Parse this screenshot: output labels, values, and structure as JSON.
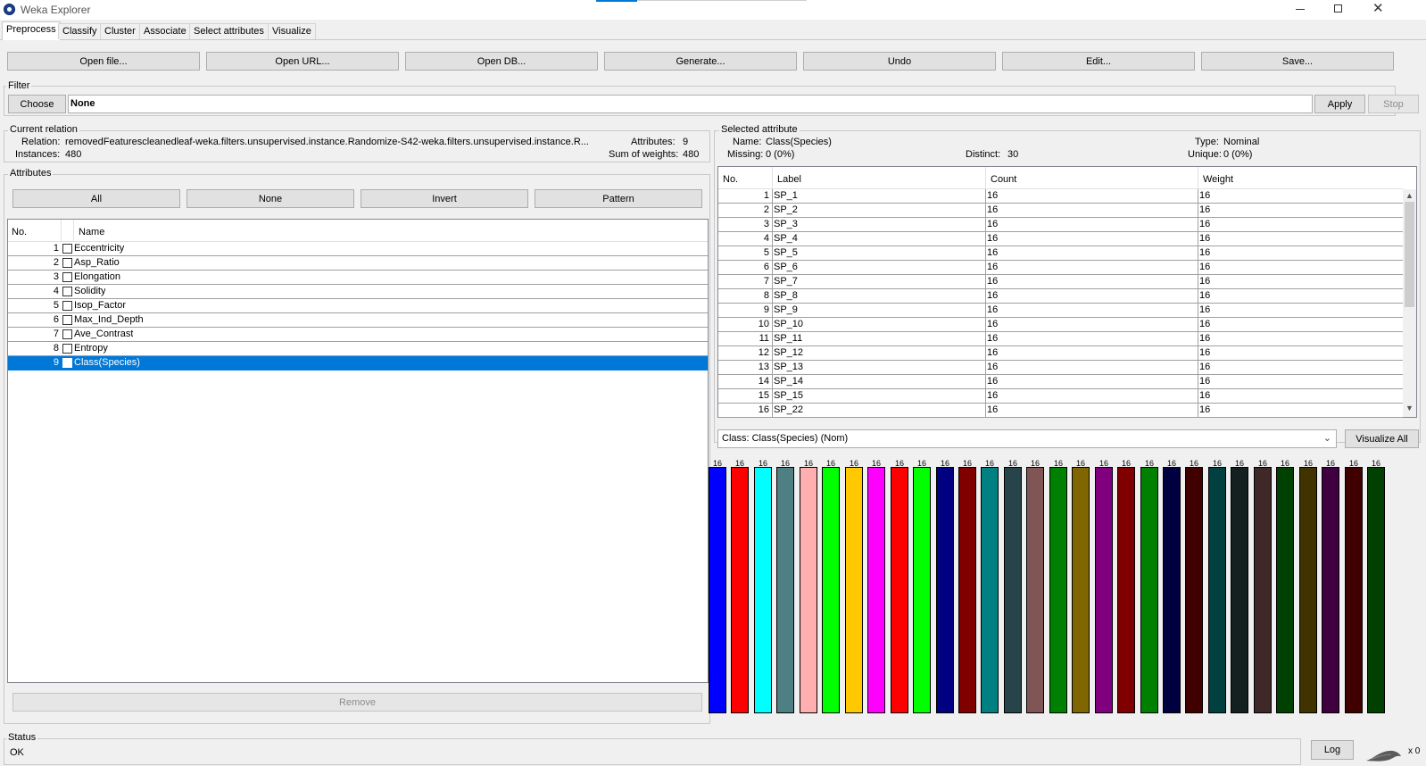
{
  "window": {
    "title": "Weka Explorer",
    "minimize_icon": "minimize-icon",
    "maximize_icon": "restore-icon",
    "close_icon": "close-icon"
  },
  "tabs": [
    "Preprocess",
    "Classify",
    "Cluster",
    "Associate",
    "Select attributes",
    "Visualize"
  ],
  "toolbar": {
    "open_file": "Open file...",
    "open_url": "Open URL...",
    "open_db": "Open DB...",
    "generate": "Generate...",
    "undo": "Undo",
    "edit": "Edit...",
    "save": "Save..."
  },
  "filter": {
    "legend": "Filter",
    "choose": "Choose",
    "value": "None",
    "apply": "Apply",
    "stop": "Stop"
  },
  "current_relation": {
    "legend": "Current relation",
    "relation_label": "Relation:",
    "relation_value": "removedFeaturescleanedleaf-weka.filters.unsupervised.instance.Randomize-S42-weka.filters.unsupervised.instance.R...",
    "instances_label": "Instances:",
    "instances_value": "480",
    "attributes_label": "Attributes:",
    "attributes_value": "9",
    "sum_weights_label": "Sum of weights:",
    "sum_weights_value": "480"
  },
  "attributes": {
    "legend": "Attributes",
    "all": "All",
    "none": "None",
    "invert": "Invert",
    "pattern": "Pattern",
    "col_no": "No.",
    "col_name": "Name",
    "rows": [
      {
        "no": "1",
        "name": "Eccentricity"
      },
      {
        "no": "2",
        "name": "Asp_Ratio"
      },
      {
        "no": "3",
        "name": "Elongation"
      },
      {
        "no": "4",
        "name": "Solidity"
      },
      {
        "no": "5",
        "name": "Isop_Factor"
      },
      {
        "no": "6",
        "name": "Max_Ind_Depth"
      },
      {
        "no": "7",
        "name": "Ave_Contrast"
      },
      {
        "no": "8",
        "name": "Entropy"
      },
      {
        "no": "9",
        "name": "Class(Species)"
      }
    ],
    "remove": "Remove"
  },
  "selected_attribute": {
    "legend": "Selected attribute",
    "name_label": "Name:",
    "name_value": "Class(Species)",
    "type_label": "Type:",
    "type_value": "Nominal",
    "missing_label": "Missing:",
    "missing_value": "0 (0%)",
    "distinct_label": "Distinct:",
    "distinct_value": "30",
    "unique_label": "Unique:",
    "unique_value": "0 (0%)",
    "col_no": "No.",
    "col_label": "Label",
    "col_count": "Count",
    "col_weight": "Weight",
    "rows": [
      {
        "no": "1",
        "label": "SP_1",
        "count": "16",
        "weight": "16"
      },
      {
        "no": "2",
        "label": "SP_2",
        "count": "16",
        "weight": "16"
      },
      {
        "no": "3",
        "label": "SP_3",
        "count": "16",
        "weight": "16"
      },
      {
        "no": "4",
        "label": "SP_4",
        "count": "16",
        "weight": "16"
      },
      {
        "no": "5",
        "label": "SP_5",
        "count": "16",
        "weight": "16"
      },
      {
        "no": "6",
        "label": "SP_6",
        "count": "16",
        "weight": "16"
      },
      {
        "no": "7",
        "label": "SP_7",
        "count": "16",
        "weight": "16"
      },
      {
        "no": "8",
        "label": "SP_8",
        "count": "16",
        "weight": "16"
      },
      {
        "no": "9",
        "label": "SP_9",
        "count": "16",
        "weight": "16"
      },
      {
        "no": "10",
        "label": "SP_10",
        "count": "16",
        "weight": "16"
      },
      {
        "no": "11",
        "label": "SP_11",
        "count": "16",
        "weight": "16"
      },
      {
        "no": "12",
        "label": "SP_12",
        "count": "16",
        "weight": "16"
      },
      {
        "no": "13",
        "label": "SP_13",
        "count": "16",
        "weight": "16"
      },
      {
        "no": "14",
        "label": "SP_14",
        "count": "16",
        "weight": "16"
      },
      {
        "no": "15",
        "label": "SP_15",
        "count": "16",
        "weight": "16"
      },
      {
        "no": "16",
        "label": "SP_22",
        "count": "16",
        "weight": "16"
      }
    ]
  },
  "class_select": {
    "value": "Class: Class(Species) (Nom)",
    "visualize_all": "Visualize All"
  },
  "histogram": {
    "value_per_bar": 16,
    "colors": [
      "#0000ff",
      "#ff0000",
      "#00ffff",
      "#4e7f82",
      "#ffafaf",
      "#00ff00",
      "#ffc800",
      "#ff00ff",
      "#ff0000",
      "#00ff00",
      "#000080",
      "#800000",
      "#008080",
      "#264449",
      "#7f5555",
      "#008000",
      "#806600",
      "#800080",
      "#800000",
      "#008000",
      "#000040",
      "#400000",
      "#004040",
      "#142020",
      "#3f2828",
      "#004000",
      "#403300",
      "#400040",
      "#400000",
      "#004000"
    ],
    "labels": [
      "16",
      "16",
      "16",
      "16",
      "16",
      "16",
      "16",
      "16",
      "16",
      "16",
      "16",
      "16",
      "16",
      "16",
      "16",
      "16",
      "16",
      "16",
      "16",
      "16",
      "16",
      "16",
      "16",
      "16",
      "16",
      "16",
      "16",
      "16",
      "16",
      "16"
    ]
  },
  "status": {
    "legend": "Status",
    "text": "OK",
    "log": "Log",
    "count": "x 0"
  }
}
